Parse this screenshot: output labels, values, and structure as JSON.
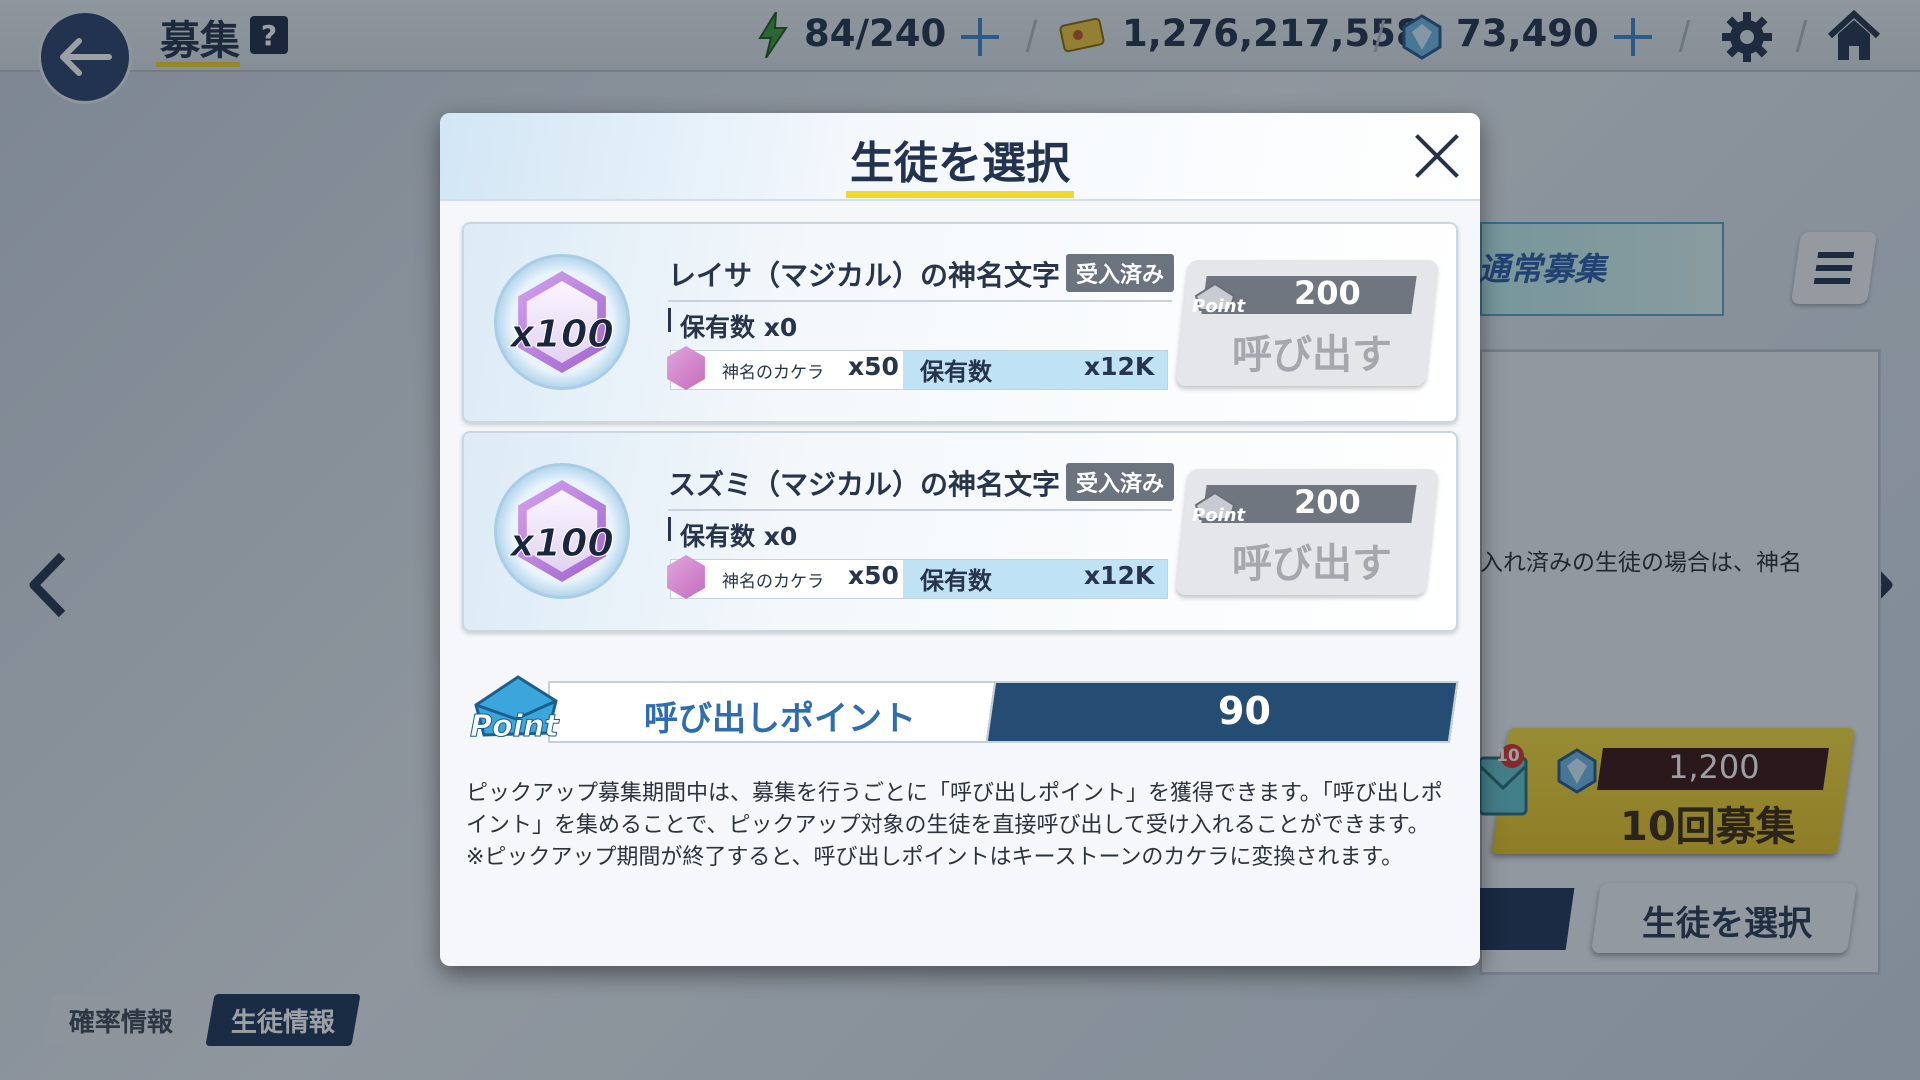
{
  "topbar": {
    "title": "募集",
    "help": "?",
    "ap": "84/240",
    "credits": "1,276,217,558",
    "pyroxene": "73,490"
  },
  "background": {
    "banner_label": "通常募集",
    "note": "入れ済みの生徒の場合は、神名",
    "gacha10_cost": "1,200",
    "gacha10_label": "10回募集",
    "mail_badge": "10",
    "select_button": "生徒を選択",
    "tab_rate": "確率情報",
    "tab_student": "生徒情報"
  },
  "modal": {
    "title": "生徒を選択",
    "cards": [
      {
        "name": "レイサ（マジカル）の神名文字",
        "badge": "受入済み",
        "qty": "x100",
        "owned": "保有数 x0",
        "kakera_name": "神名のカケラ",
        "kakera_cost": "x50",
        "kakera_owned_label": "保有数",
        "kakera_owned_value": "x12K",
        "point_tag": "Point",
        "cost": "200",
        "button": "呼び出す"
      },
      {
        "name": "スズミ（マジカル）の神名文字",
        "badge": "受入済み",
        "qty": "x100",
        "owned": "保有数 x0",
        "kakera_name": "神名のカケラ",
        "kakera_cost": "x50",
        "kakera_owned_label": "保有数",
        "kakera_owned_value": "x12K",
        "point_tag": "Point",
        "cost": "200",
        "button": "呼び出す"
      }
    ],
    "points": {
      "icon_label": "Point",
      "label": "呼び出しポイント",
      "value": "90"
    },
    "description": [
      "ピックアップ募集期間中は、募集を行うごとに「呼び出しポイント」を獲得できます。「呼び出しポイント」を集めることで、ピックアップ対象の生徒を直接呼び出して受け入れることができます。",
      "※ピックアップ期間が終了すると、呼び出しポイントはキーストーンのカケラに変換されます。"
    ]
  }
}
